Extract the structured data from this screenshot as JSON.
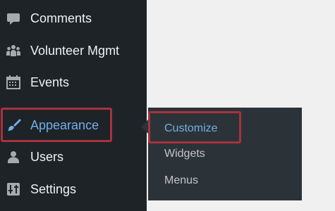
{
  "sidebar": {
    "items": [
      {
        "label": "Comments",
        "icon": "comment-icon"
      },
      {
        "label": "Volunteer Mgmt",
        "icon": "people-icon"
      },
      {
        "label": "Events",
        "icon": "calendar-icon"
      },
      {
        "label": "Appearance",
        "icon": "paintbrush-icon",
        "active": true
      },
      {
        "label": "Users",
        "icon": "user-icon"
      },
      {
        "label": "Settings",
        "icon": "settings-sliders-icon"
      }
    ]
  },
  "flyout": {
    "items": [
      {
        "label": "Customize",
        "active": true
      },
      {
        "label": "Widgets"
      },
      {
        "label": "Menus"
      }
    ]
  },
  "colors": {
    "sidebar_bg": "#1d2327",
    "flyout_bg": "#2c3338",
    "page_bg": "#f0f0f1",
    "accent": "#72aee6",
    "highlight_border": "#a8323e",
    "text": "#f0f0f1",
    "submenu_text": "#c3c4c7"
  }
}
